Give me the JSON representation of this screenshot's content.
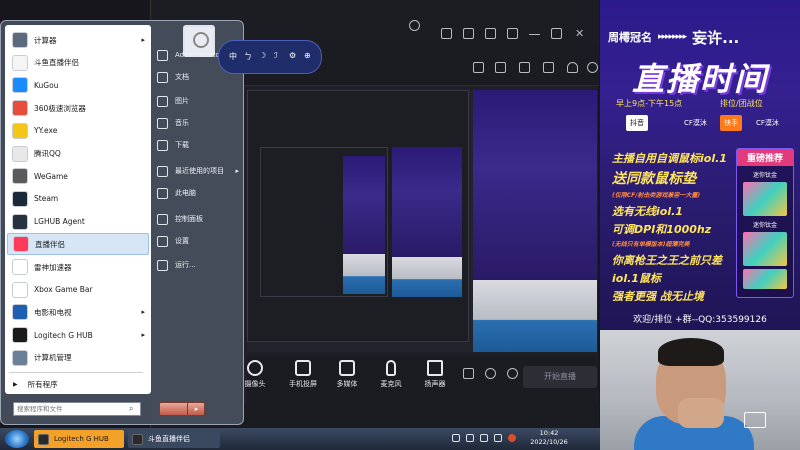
{
  "start_menu": {
    "programs": [
      {
        "label": "计算器",
        "icon": "calculator-icon",
        "color": "#5b6a7e",
        "has_arrow": true
      },
      {
        "label": "斗鱼直播伴侣",
        "icon": "douyu-icon",
        "color": "#f5f5f5",
        "has_arrow": false
      },
      {
        "label": "KuGou",
        "icon": "kugou-icon",
        "color": "#1a8cff",
        "has_arrow": false
      },
      {
        "label": "360极速浏览器",
        "icon": "browser-360-icon",
        "color": "#e84c3d",
        "has_arrow": false
      },
      {
        "label": "YY.exe",
        "icon": "yy-icon",
        "color": "#f5c518",
        "has_arrow": false
      },
      {
        "label": "腾讯QQ",
        "icon": "qq-icon",
        "color": "#e8e8e8",
        "has_arrow": false
      },
      {
        "label": "WeGame",
        "icon": "wegame-icon",
        "color": "#5a5a5a",
        "has_arrow": false
      },
      {
        "label": "Steam",
        "icon": "steam-icon",
        "color": "#1b2838",
        "has_arrow": false
      },
      {
        "label": "LGHUB Agent",
        "icon": "lghub-icon",
        "color": "#263240",
        "has_arrow": false
      },
      {
        "label": "直播伴侣",
        "icon": "live-companion-icon",
        "color": "#ff3b5c",
        "has_arrow": false
      },
      {
        "label": "雷神加速器",
        "icon": "leishen-icon",
        "color": "#ffffff",
        "has_arrow": false
      },
      {
        "label": "Xbox Game Bar",
        "icon": "xbox-icon",
        "color": "#ffffff",
        "has_arrow": false
      },
      {
        "label": "电影和电视",
        "icon": "movies-tv-icon",
        "color": "#1f5fb3",
        "has_arrow": true
      },
      {
        "label": "Logitech G HUB",
        "icon": "ghub-icon",
        "color": "#1a1a1a",
        "has_arrow": true
      },
      {
        "label": "计算机管理",
        "icon": "computer-management-icon",
        "color": "#6c7f99",
        "has_arrow": false
      }
    ],
    "highlighted_index": 9,
    "all_programs": "所有程序",
    "search_placeholder": "搜索程序和文件",
    "right_items": [
      {
        "label": "Administrator",
        "icon": "user-folder-icon"
      },
      {
        "label": "文档",
        "icon": "documents-icon"
      },
      {
        "label": "图片",
        "icon": "pictures-icon"
      },
      {
        "label": "音乐",
        "icon": "music-icon"
      },
      {
        "label": "下载",
        "icon": "downloads-icon"
      },
      {
        "label": "最近使用的项目",
        "icon": "recent-items-icon",
        "has_arrow": true
      },
      {
        "label": "此电脑",
        "icon": "computer-icon"
      },
      {
        "label": "控制面板",
        "icon": "control-panel-icon"
      },
      {
        "label": "设置",
        "icon": "settings-icon"
      },
      {
        "label": "运行...",
        "icon": "run-icon"
      }
    ]
  },
  "floating_toolbar": {
    "items": [
      "中",
      "ㄅ",
      "☽",
      "ℐ",
      "⚙",
      "⊕"
    ]
  },
  "app": {
    "controls": [
      {
        "label": "摄像头",
        "icon": "camera-icon"
      },
      {
        "label": "手机投屏",
        "icon": "phone-cast-icon"
      },
      {
        "label": "多媒体",
        "icon": "multimedia-icon"
      },
      {
        "label": "麦克风",
        "icon": "microphone-icon"
      },
      {
        "label": "扬声器",
        "icon": "speaker-icon"
      }
    ],
    "start_live": "开始直播"
  },
  "poster": {
    "org": "周樗冠名",
    "arrows": "▸▸▸▸▸▸▸▸",
    "name": "妄许...",
    "title": "直播时间",
    "schedule": "早上9点-下午15点",
    "rank": "排位/团战位",
    "platform1": "抖音",
    "platform1_label": "CF漠沐",
    "platform2": "快手",
    "platform2_label": "CF漠沐",
    "perks": [
      {
        "text": "主播自用自调鼠标iol.1",
        "size": "med"
      },
      {
        "text": "送同款鼠标垫",
        "size": "big"
      },
      {
        "text": "(仅限CF/射击类游戏兼容一大量)",
        "size": "small"
      },
      {
        "text": "选有无线iol.1",
        "size": "med"
      },
      {
        "text": "可调DPI和1000hz",
        "size": "med"
      },
      {
        "text": "(无线只有单模版本)超薄完美",
        "size": "small"
      },
      {
        "text": "你离枪王之王之前只差",
        "size": "med"
      },
      {
        "text": "iol.1鼠标",
        "size": "med"
      },
      {
        "text": "强者更强 战无止境",
        "size": "med"
      }
    ],
    "recommend_title": "重磅推荐",
    "recommend_sub1": "迷你钛金",
    "recommend_sub2": "迷你钛金",
    "footer": "欢迎/排位  +群--QQ:353599126"
  },
  "taskbar": {
    "buttons": [
      {
        "label": "Logitech G HUB",
        "icon": "ghub-icon",
        "bg": "#f4a12a",
        "fg": "#1a1a1a"
      },
      {
        "label": "斗鱼直播伴侣",
        "icon": "douyu-icon",
        "bg": "#3a4860",
        "fg": "#ffffff"
      }
    ],
    "time": "10:42",
    "date": "2022/10/26"
  }
}
